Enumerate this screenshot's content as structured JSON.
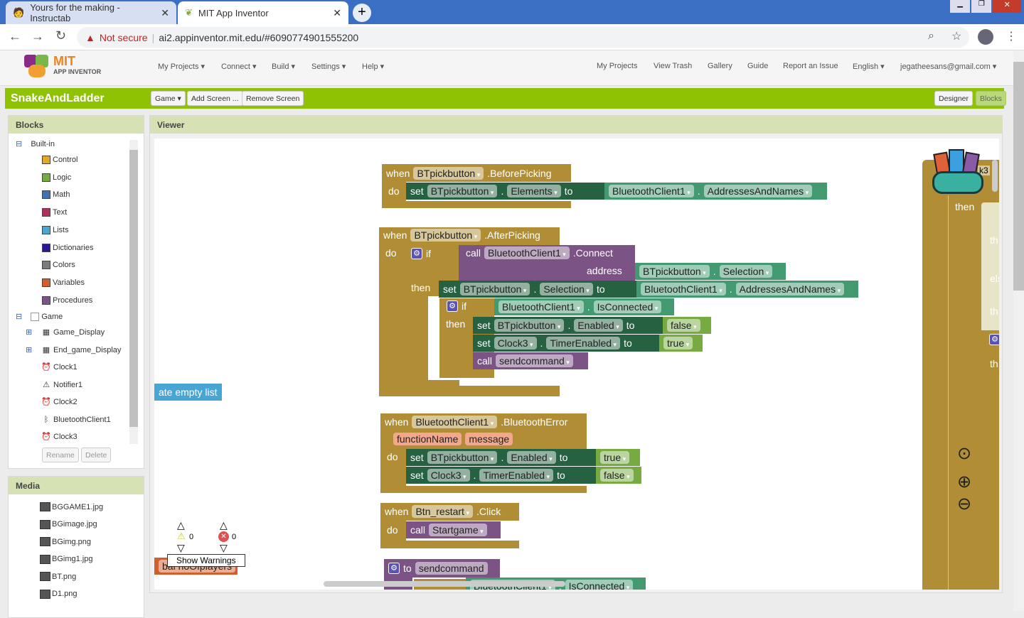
{
  "browser": {
    "tabs": [
      {
        "title": "Yours for the making - Instructab",
        "active": false
      },
      {
        "title": "MIT App Inventor",
        "active": true
      }
    ],
    "security": "Not secure",
    "url": "ai2.appinventor.mit.edu/#6090774901555200"
  },
  "header": {
    "logo": "MIT APP INVENTOR",
    "logo_top": "MIT",
    "logo_bottom": "APP INVENTOR",
    "menus": [
      "My Projects ▾",
      "Connect ▾",
      "Build ▾",
      "Settings ▾",
      "Help ▾"
    ],
    "right_links": [
      "My Projects",
      "View Trash",
      "Gallery",
      "Guide",
      "Report an Issue",
      "English ▾",
      "jegatheesans@gmail.com ▾"
    ]
  },
  "project": {
    "name": "SnakeAndLadder",
    "screen": "Game ▾",
    "add_screen": "Add Screen ...",
    "remove_screen": "Remove Screen",
    "designer": "Designer",
    "blocks": "Blocks",
    "active_view": "Blocks"
  },
  "blocks_panel": {
    "title": "Blocks",
    "builtin": "Built-in",
    "builtins": [
      {
        "label": "Control",
        "color": "#e1a92c"
      },
      {
        "label": "Logic",
        "color": "#77ab41"
      },
      {
        "label": "Math",
        "color": "#3f71b5"
      },
      {
        "label": "Text",
        "color": "#b32d5e"
      },
      {
        "label": "Lists",
        "color": "#49a6d4"
      },
      {
        "label": "Dictionaries",
        "color": "#2d1799"
      },
      {
        "label": "Colors",
        "color": "#7d7d7d"
      },
      {
        "label": "Variables",
        "color": "#d05f2d"
      },
      {
        "label": "Procedures",
        "color": "#7c5385"
      }
    ],
    "screen": "Game",
    "components": [
      {
        "label": "Game_Display",
        "icon": "arrangement-icon",
        "expandable": true
      },
      {
        "label": "End_game_Display",
        "icon": "arrangement-icon",
        "expandable": true
      },
      {
        "label": "Clock1",
        "icon": "clock-icon"
      },
      {
        "label": "Notifier1",
        "icon": "warning-icon"
      },
      {
        "label": "Clock2",
        "icon": "clock-icon"
      },
      {
        "label": "BluetoothClient1",
        "icon": "bluetooth-icon"
      },
      {
        "label": "Clock3",
        "icon": "clock-icon"
      }
    ],
    "rename": "Rename",
    "delete": "Delete"
  },
  "media_panel": {
    "title": "Media",
    "files": [
      "BGGAME1.jpg",
      "BGimage.jpg",
      "BGimg.png",
      "BGimg1.jpg",
      "BT.png",
      "D1.png"
    ]
  },
  "viewer": {
    "title": "Viewer",
    "warnings_count": "0",
    "errors_count": "0",
    "show_warnings": "Show Warnings"
  },
  "kw": {
    "when": "when",
    "do": "do",
    "set": "set",
    "to": "to",
    "call": "call",
    "if": "if",
    "then": "then",
    "dot": ".",
    "address": "address"
  },
  "blocks": {
    "b1": {
      "component": "BTpickbutton",
      "event": ".BeforePicking",
      "set_comp": "BTpickbutton",
      "set_prop": "Elements",
      "get_comp": "BluetoothClient1",
      "get_prop": "AddressesAndNames"
    },
    "b2": {
      "component": "BTpickbutton",
      "event": ".AfterPicking",
      "call_comp": "BluetoothClient1",
      "call_method": ".Connect",
      "addr_comp": "BTpickbutton",
      "addr_prop": "Selection",
      "set1_comp": "BTpickbutton",
      "set1_prop": "Selection",
      "get1_comp": "BluetoothClient1",
      "get1_prop": "AddressesAndNames",
      "if_comp": "BluetoothClient1",
      "if_prop": "IsConnected",
      "set2_comp": "BTpickbutton",
      "set2_prop": "Enabled",
      "set2_val": "false",
      "set3_comp": "Clock3",
      "set3_prop": "TimerEnabled",
      "set3_val": "true",
      "call2": "sendcommand"
    },
    "b3": {
      "component": "BluetoothClient1",
      "event": ".BluetoothError",
      "param1": "functionName",
      "param2": "message",
      "set1_comp": "BTpickbutton",
      "set1_prop": "Enabled",
      "set1_val": "true",
      "set2_comp": "Clock3",
      "set2_prop": "TimerEnabled",
      "set2_val": "false"
    },
    "b4": {
      "component": "Btn_restart",
      "event": ".Click",
      "call": "Startgame"
    },
    "b5": {
      "to": "to",
      "name": "sendcommand",
      "get_comp": "BluetoothClient1",
      "get_prop": "IsConnected"
    },
    "partial_list": "ate empty list",
    "partial_var": "bal noOfplayers",
    "partial_right": {
      "comp": "k3",
      "then": "then",
      "then2": "th",
      "else": "els",
      "then3": "th",
      "then4": "th"
    }
  },
  "colors": {
    "event": "#b18e35",
    "setter": "#266141",
    "getter": "#439970",
    "procedure": "#7c5385",
    "logic": "#77ab41",
    "app_bar": "#8fc202"
  }
}
